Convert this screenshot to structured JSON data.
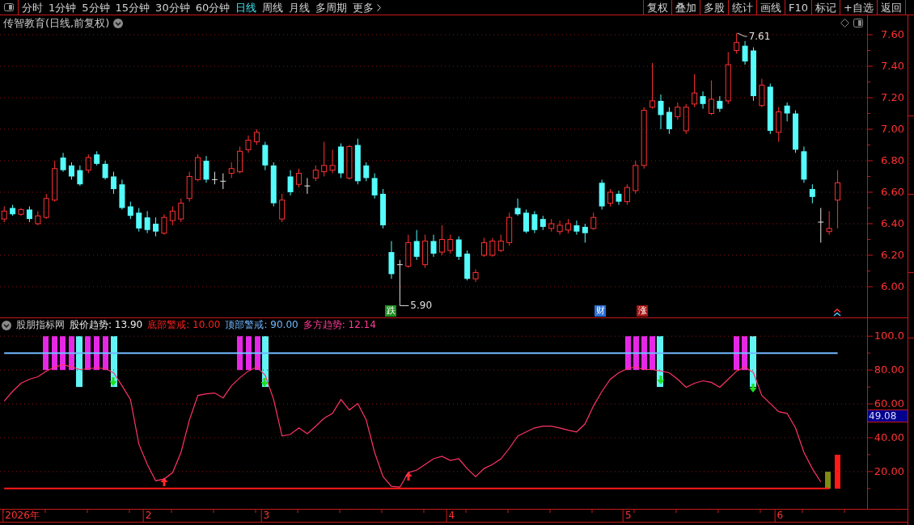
{
  "toolbar": {
    "tabs": [
      {
        "label": "分时",
        "selected": false
      },
      {
        "label": "1分钟",
        "selected": false
      },
      {
        "label": "5分钟",
        "selected": false
      },
      {
        "label": "15分钟",
        "selected": false
      },
      {
        "label": "30分钟",
        "selected": false
      },
      {
        "label": "60分钟",
        "selected": false
      },
      {
        "label": "日线",
        "selected": true
      },
      {
        "label": "周线",
        "selected": false
      },
      {
        "label": "月线",
        "selected": false
      },
      {
        "label": "多周期",
        "selected": false
      }
    ],
    "more_button": "更多",
    "buttons": [
      "复权",
      "叠加",
      "多股",
      "统计",
      "画线",
      "F10",
      "标记",
      "+自选",
      "返回"
    ]
  },
  "price_chart": {
    "title": "传智教育(日线,前复权)",
    "chart_data": {
      "type": "candlestick",
      "categories": [
        null,
        null,
        null,
        null,
        null,
        null,
        null,
        null,
        null,
        null,
        null,
        null,
        null,
        null,
        null,
        null,
        null,
        null,
        null,
        null,
        null,
        null,
        null,
        null,
        null,
        null,
        null,
        null,
        null,
        null,
        null,
        null,
        null,
        null,
        null,
        null,
        null,
        null,
        null,
        null,
        null,
        null,
        null,
        null,
        null,
        null,
        null,
        null,
        null,
        null,
        null,
        null,
        null,
        null,
        null,
        null,
        null,
        null,
        null,
        null,
        null,
        null,
        null,
        null,
        null,
        null,
        null,
        null,
        null,
        null,
        null,
        null,
        null,
        null,
        null,
        null,
        null,
        null,
        null,
        null,
        null,
        null,
        null,
        null,
        null,
        null,
        null,
        null,
        null,
        null,
        null,
        null,
        null,
        null,
        null,
        null,
        null,
        null,
        null,
        null,
        null,
        null,
        null
      ],
      "ohlc": [
        [
          6.43,
          6.51,
          6.41,
          6.48
        ],
        [
          6.5,
          6.52,
          6.45,
          6.46
        ],
        [
          6.46,
          6.5,
          6.45,
          6.49
        ],
        [
          6.49,
          6.51,
          6.41,
          6.43
        ],
        [
          6.4,
          6.48,
          6.39,
          6.45
        ],
        [
          6.44,
          6.59,
          6.43,
          6.56
        ],
        [
          6.55,
          6.8,
          6.54,
          6.75
        ],
        [
          6.82,
          6.85,
          6.73,
          6.74
        ],
        [
          6.77,
          6.79,
          6.68,
          6.7
        ],
        [
          6.74,
          6.77,
          6.64,
          6.65
        ],
        [
          6.74,
          6.84,
          6.72,
          6.82
        ],
        [
          6.84,
          6.86,
          6.77,
          6.78
        ],
        [
          6.78,
          6.8,
          6.68,
          6.69
        ],
        [
          6.7,
          6.73,
          6.59,
          6.62
        ],
        [
          6.65,
          6.68,
          6.49,
          6.5
        ],
        [
          6.51,
          6.54,
          6.43,
          6.45
        ],
        [
          6.47,
          6.5,
          6.35,
          6.37
        ],
        [
          6.44,
          6.48,
          6.34,
          6.36
        ],
        [
          6.4,
          6.44,
          6.32,
          6.35
        ],
        [
          6.34,
          6.46,
          6.33,
          6.44
        ],
        [
          6.42,
          6.51,
          6.39,
          6.48
        ],
        [
          6.43,
          6.56,
          6.41,
          6.53
        ],
        [
          6.56,
          6.73,
          6.54,
          6.7
        ],
        [
          6.68,
          6.84,
          6.67,
          6.82
        ],
        [
          6.8,
          6.83,
          6.66,
          6.68
        ],
        [
          6.68,
          6.73,
          6.65,
          6.68
        ],
        [
          6.67,
          6.72,
          6.62,
          6.67
        ],
        [
          6.72,
          6.79,
          6.69,
          6.75
        ],
        [
          6.73,
          6.89,
          6.72,
          6.86
        ],
        [
          6.87,
          6.96,
          6.85,
          6.93
        ],
        [
          6.92,
          7.0,
          6.9,
          6.98
        ],
        [
          6.9,
          6.92,
          6.74,
          6.77
        ],
        [
          6.77,
          6.79,
          6.51,
          6.53
        ],
        [
          6.43,
          6.59,
          6.41,
          6.55
        ],
        [
          6.7,
          6.74,
          6.58,
          6.6
        ],
        [
          6.65,
          6.75,
          6.63,
          6.72
        ],
        [
          6.64,
          6.69,
          6.59,
          6.64
        ],
        [
          6.69,
          6.77,
          6.67,
          6.74
        ],
        [
          6.73,
          6.92,
          6.7,
          6.77
        ],
        [
          6.74,
          6.87,
          6.72,
          6.77
        ],
        [
          6.89,
          6.91,
          6.69,
          6.72
        ],
        [
          6.69,
          6.9,
          6.68,
          6.89
        ],
        [
          6.9,
          6.94,
          6.65,
          6.67
        ],
        [
          6.77,
          6.79,
          6.67,
          6.69
        ],
        [
          6.69,
          6.72,
          6.56,
          6.58
        ],
        [
          6.59,
          6.62,
          6.37,
          6.39
        ],
        [
          6.22,
          6.29,
          6.05,
          6.08
        ],
        [
          6.14,
          6.17,
          5.9,
          6.14
        ],
        [
          6.13,
          6.33,
          6.12,
          6.28
        ],
        [
          6.29,
          6.36,
          6.17,
          6.19
        ],
        [
          6.14,
          6.33,
          6.12,
          6.29
        ],
        [
          6.29,
          6.33,
          6.19,
          6.21
        ],
        [
          6.22,
          6.39,
          6.2,
          6.3
        ],
        [
          6.23,
          6.33,
          6.21,
          6.3
        ],
        [
          6.3,
          6.32,
          6.17,
          6.19
        ],
        [
          6.21,
          6.23,
          6.04,
          6.05
        ],
        [
          6.05,
          6.11,
          6.03,
          6.09
        ],
        [
          6.2,
          6.31,
          6.19,
          6.28
        ],
        [
          6.2,
          6.31,
          6.19,
          6.29
        ],
        [
          6.23,
          6.33,
          6.22,
          6.29
        ],
        [
          6.28,
          6.47,
          6.26,
          6.44
        ],
        [
          6.5,
          6.56,
          6.45,
          6.46
        ],
        [
          6.47,
          6.49,
          6.34,
          6.35
        ],
        [
          6.46,
          6.48,
          6.34,
          6.36
        ],
        [
          6.43,
          6.45,
          6.36,
          6.38
        ],
        [
          6.37,
          6.43,
          6.35,
          6.4
        ],
        [
          6.35,
          6.42,
          6.33,
          6.39
        ],
        [
          6.36,
          6.43,
          6.34,
          6.4
        ],
        [
          6.39,
          6.42,
          6.33,
          6.35
        ],
        [
          6.38,
          6.4,
          6.28,
          6.34
        ],
        [
          6.37,
          6.47,
          6.36,
          6.44
        ],
        [
          6.66,
          6.68,
          6.49,
          6.51
        ],
        [
          6.53,
          6.62,
          6.51,
          6.6
        ],
        [
          6.59,
          6.61,
          6.52,
          6.54
        ],
        [
          6.54,
          6.65,
          6.52,
          6.63
        ],
        [
          6.61,
          6.8,
          6.59,
          6.77
        ],
        [
          6.77,
          7.14,
          6.75,
          7.12
        ],
        [
          7.14,
          7.42,
          7.13,
          7.18
        ],
        [
          7.18,
          7.22,
          7.0,
          7.09
        ],
        [
          7.11,
          7.14,
          6.97,
          7.0
        ],
        [
          7.08,
          7.17,
          7.06,
          7.14
        ],
        [
          6.99,
          7.16,
          6.97,
          7.14
        ],
        [
          7.16,
          7.35,
          7.14,
          7.23
        ],
        [
          7.21,
          7.24,
          7.13,
          7.16
        ],
        [
          7.1,
          7.31,
          7.09,
          7.19
        ],
        [
          7.18,
          7.21,
          7.11,
          7.13
        ],
        [
          7.18,
          7.49,
          7.16,
          7.41
        ],
        [
          7.5,
          7.61,
          7.48,
          7.55
        ],
        [
          7.53,
          7.56,
          7.41,
          7.43
        ],
        [
          7.5,
          7.52,
          7.18,
          7.21
        ],
        [
          7.15,
          7.32,
          7.14,
          7.28
        ],
        [
          7.27,
          7.29,
          6.97,
          6.99
        ],
        [
          6.98,
          7.14,
          6.92,
          7.11
        ],
        [
          7.15,
          7.17,
          7.05,
          7.1
        ],
        [
          7.1,
          7.12,
          6.85,
          6.87
        ],
        [
          6.86,
          6.89,
          6.66,
          6.68
        ],
        [
          6.62,
          6.65,
          6.53,
          6.57
        ],
        [
          6.41,
          6.5,
          6.28,
          6.41
        ],
        [
          6.35,
          6.48,
          6.33,
          6.37
        ],
        [
          6.55,
          6.74,
          6.37,
          6.66
        ],
        null,
        null,
        null
      ],
      "ylim": [
        5.805,
        7.723
      ],
      "yticks": [
        {
          "value": 7.6,
          "label": "7.60"
        },
        {
          "value": 7.4,
          "label": "7.40"
        },
        {
          "value": 7.2,
          "label": "7.20"
        },
        {
          "value": 7.0,
          "label": "7.00"
        },
        {
          "value": 6.8,
          "label": "6.80"
        },
        {
          "value": 6.6,
          "label": "6.60"
        },
        {
          "value": 6.4,
          "label": "6.40"
        },
        {
          "value": 6.2,
          "label": "6.20"
        },
        {
          "value": 6.0,
          "label": "6.00"
        }
      ],
      "grid": true
    },
    "high_label": "7.61",
    "low_label": "5.90",
    "signal_tags": [
      {
        "text": "跌",
        "color": "#1f8f1f"
      },
      {
        "text": "财",
        "color": "#2a6fd6"
      },
      {
        "text": "涨",
        "color": "#a31515"
      }
    ]
  },
  "indicator": {
    "name": "股朋指标网",
    "legend": [
      {
        "text": "股价趋势: 13.90",
        "color": "#ececec"
      },
      {
        "text": "底部警戒: 10.00",
        "color": "#ff2020"
      },
      {
        "text": "顶部警戒: 90.00",
        "color": "#70b8ff"
      },
      {
        "text": "多方趋势: 12.14",
        "color": "#ff3c96"
      }
    ],
    "cursor_value": "49.08",
    "chart_data": {
      "type": "line",
      "categories": [
        null,
        null,
        "2026年",
        null,
        null,
        null,
        null,
        null,
        null,
        null,
        null,
        null,
        null,
        null,
        null,
        null,
        null,
        "2",
        null,
        null,
        null,
        null,
        null,
        null,
        null,
        null,
        null,
        null,
        null,
        null,
        null,
        "3",
        null,
        null,
        null,
        null,
        null,
        null,
        null,
        null,
        null,
        null,
        null,
        null,
        null,
        null,
        null,
        null,
        null,
        null,
        null,
        null,
        null,
        "4",
        null,
        null,
        null,
        null,
        null,
        null,
        null,
        null,
        null,
        null,
        null,
        null,
        null,
        null,
        null,
        null,
        null,
        null,
        null,
        null,
        "5",
        null,
        null,
        null,
        null,
        null,
        null,
        null,
        null,
        null,
        null,
        null,
        null,
        null,
        null,
        null,
        null,
        null,
        "6",
        null,
        null,
        null,
        null,
        null,
        null,
        null,
        null,
        null,
        null
      ],
      "ylim": [
        -2,
        110.6
      ],
      "yticks": [
        {
          "value": 100,
          "label": "100.0"
        },
        {
          "value": 80,
          "label": "80.00"
        },
        {
          "value": 60,
          "label": "60.00"
        },
        {
          "value": 40,
          "label": "40.00"
        },
        {
          "value": 20,
          "label": "20.00"
        }
      ],
      "grid": true,
      "series": [
        {
          "color": "#ff3366",
          "values": [
            61.6,
            67.4,
            72.2,
            74.6,
            76.0,
            79.4,
            81.8,
            83.2,
            81.8,
            80.3,
            80.8,
            81.3,
            80.8,
            78.4,
            70.7,
            62.6,
            36.2,
            24.2,
            14.6,
            15.6,
            19.4,
            31.4,
            50.6,
            65.0,
            65.9,
            66.4,
            63.5,
            70.7,
            75.5,
            79.4,
            81.8,
            77.0,
            62.6,
            41.0,
            42.0,
            45.8,
            42.4,
            46.8,
            51.6,
            54.4,
            62.6,
            56.4,
            60.2,
            50.6,
            31.4,
            17.0,
            11.3,
            10.8,
            19.4,
            20.9,
            24.2,
            27.6,
            29.0,
            26.6,
            27.6,
            21.8,
            17.0,
            21.8,
            24.2,
            27.6,
            33.8,
            41.0,
            43.4,
            45.8,
            46.8,
            46.8,
            45.8,
            44.4,
            43.4,
            48.2,
            58.8,
            67.4,
            74.6,
            78.4,
            80.8,
            81.8,
            80.3,
            80.3,
            79.4,
            78.4,
            74.6,
            69.8,
            72.2,
            73.6,
            72.7,
            69.8,
            74.6,
            79.4,
            81.8,
            78.4,
            65.0,
            60.2,
            55.4,
            54.4,
            45.8,
            31.4,
            21.8,
            13.9,
            null,
            null,
            null,
            null,
            null
          ]
        },
        {
          "color": "#70b8ff",
          "values": [
            90,
            90,
            90,
            90,
            90,
            90,
            90,
            90,
            90,
            90,
            90,
            90,
            90,
            90,
            90,
            90,
            90,
            90,
            90,
            90,
            90,
            90,
            90,
            90,
            90,
            90,
            90,
            90,
            90,
            90,
            90,
            90,
            90,
            90,
            90,
            90,
            90,
            90,
            90,
            90,
            90,
            90,
            90,
            90,
            90,
            90,
            90,
            90,
            90,
            90,
            90,
            90,
            90,
            90,
            90,
            90,
            90,
            90,
            90,
            90,
            90,
            90,
            90,
            90,
            90,
            90,
            90,
            90,
            90,
            90,
            90,
            90,
            90,
            90,
            90,
            90,
            90,
            90,
            90,
            90,
            90,
            90,
            90,
            90,
            90,
            90,
            90,
            90,
            90,
            90,
            90,
            90,
            90,
            90,
            90,
            90,
            90,
            90,
            90,
            90,
            null,
            null,
            null
          ]
        },
        {
          "color": "#ff1a1a",
          "values": [
            10,
            10,
            10,
            10,
            10,
            10,
            10,
            10,
            10,
            10,
            10,
            10,
            10,
            10,
            10,
            10,
            10,
            10,
            10,
            10,
            10,
            10,
            10,
            10,
            10,
            10,
            10,
            10,
            10,
            10,
            10,
            10,
            10,
            10,
            10,
            10,
            10,
            10,
            10,
            10,
            10,
            10,
            10,
            10,
            10,
            10,
            10,
            10,
            10,
            10,
            10,
            10,
            10,
            10,
            10,
            10,
            10,
            10,
            10,
            10,
            10,
            10,
            10,
            10,
            10,
            10,
            10,
            10,
            10,
            10,
            10,
            10,
            10,
            10,
            10,
            10,
            10,
            10,
            10,
            10,
            10,
            10,
            10,
            10,
            10,
            10,
            10,
            10,
            10,
            10,
            10,
            10,
            10,
            10,
            10,
            10,
            10,
            10,
            10,
            null,
            null,
            null,
            null
          ]
        }
      ]
    }
  }
}
